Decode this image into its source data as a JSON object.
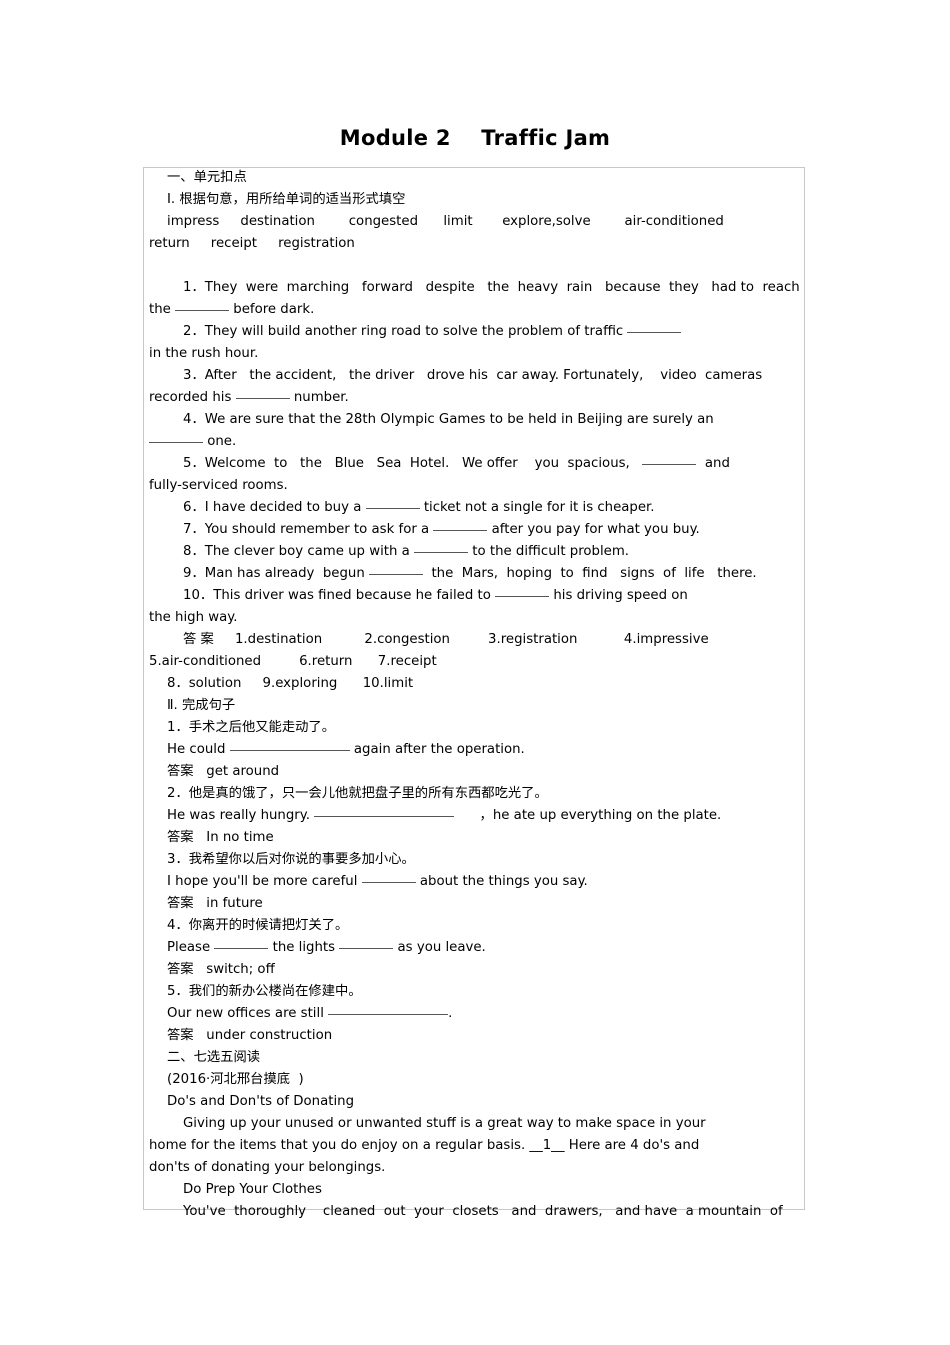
{
  "document": {
    "title": "Module 2    Traffic Jam"
  },
  "section_one": {
    "heading": "一、单元扣点",
    "part_i_heading": "Ⅰ. 根据句意，用所给单词的适当形式填空",
    "word_bank_line_1": "impress     destination        congested      limit       explore,solve        air-conditioned",
    "word_bank_line_2": "return     receipt     registration",
    "questions": [
      {
        "line_1": "1．They  were  marching   forward   despite   the  heavy  rain   because  they   had to  reach",
        "line_2_before": "the ",
        "line_2_after": " before dark."
      },
      {
        "line_1_before": "2．They will build another ring road to solve the problem of traffic ",
        "line_1_after": "",
        "line_2": "in the rush hour."
      },
      {
        "line_1": "3．After   the accident,   the driver   drove his  car away. Fortunately,    video  cameras",
        "line_2_before": "recorded his ",
        "line_2_after": " number."
      },
      {
        "line_1": "4．We are sure that the 28th Olympic Games to be held in Beijing are surely an",
        "line_2_after": " one."
      },
      {
        "line_1_before": "5．Welcome  to   the   Blue   Sea  Hotel.   We offer    you  spacious,   ",
        "line_1_after": "  and",
        "line_2": "fully-serviced rooms."
      },
      {
        "line_1_before": "6．I have decided to buy a ",
        "line_1_after": " ticket not a single for it is cheaper."
      },
      {
        "line_1_before": "7．You should remember to ask for a ",
        "line_1_after": " after you pay for what you buy."
      },
      {
        "line_1_before": "8．The clever boy came up with a ",
        "line_1_after": " to the difficult problem."
      },
      {
        "line_1_before": "9．Man has already  begun ",
        "line_1_after": "  the  Mars,  hoping  to  find   signs  of  life   there."
      },
      {
        "line_1_before": "10．This driver was fined because he failed to ",
        "line_1_after": " his driving speed on",
        "line_2": "the high way."
      }
    ],
    "answers_line_1": "答 案     1.destination          2.congestion         3.registration           4.impressive",
    "answers_line_2": "5.air-conditioned         6.return      7.receipt",
    "answers_line_3": "8．solution     9.exploring      10.limit",
    "part_ii_heading": "Ⅱ. 完成句子",
    "sentences": [
      {
        "chinese": "1．手术之后他又能走动了。",
        "english_before": "He could ",
        "english_after": " again after the operation.",
        "answer_label": "答案",
        "answer": "get around"
      },
      {
        "chinese": "2．他是真的饿了，只一会儿他就把盘子里的所有东西都吃光了。",
        "english_before": "He was really hungry. ",
        "english_after": "      ，he ate up everything on the plate.",
        "answer_label": "答案",
        "answer": "In no time"
      },
      {
        "chinese": "3．我希望你以后对你说的事要多加小心。",
        "english_before": "I hope you'll be more careful ",
        "english_after": " about the things you say.",
        "answer_label": "答案",
        "answer": "in future"
      },
      {
        "chinese": "4．你离开的时候请把灯关了。",
        "english_before": "Please ",
        "english_mid": " the lights ",
        "english_after": " as you leave.",
        "answer_label": "答案",
        "answer": "switch; off"
      },
      {
        "chinese": "5．我们的新办公楼尚在修建中。",
        "english_before": "Our new offices are still ",
        "english_after": ".",
        "answer_label": "答案",
        "answer": "under construction"
      }
    ]
  },
  "section_two": {
    "heading": "二、七选五阅读",
    "source": "(2016·河北邢台摸底  )",
    "passage_title": "Do's and Don'ts of Donating",
    "paragraph_1_line_1": "Giving up your unused or unwanted stuff is a great way to make space in your",
    "paragraph_1_line_2_before": "home for the items that you do enjoy on a regular basis. ",
    "paragraph_1_blank": "__1__",
    "paragraph_1_line_2_after": " Here are 4 do's and",
    "paragraph_1_line_3": "don'ts of donating your belongings.",
    "subheading_1": "Do Prep Your Clothes",
    "paragraph_2_line_1": "You've  thoroughly    cleaned  out  your  closets   and  drawers,   and have  a mountain  of"
  }
}
